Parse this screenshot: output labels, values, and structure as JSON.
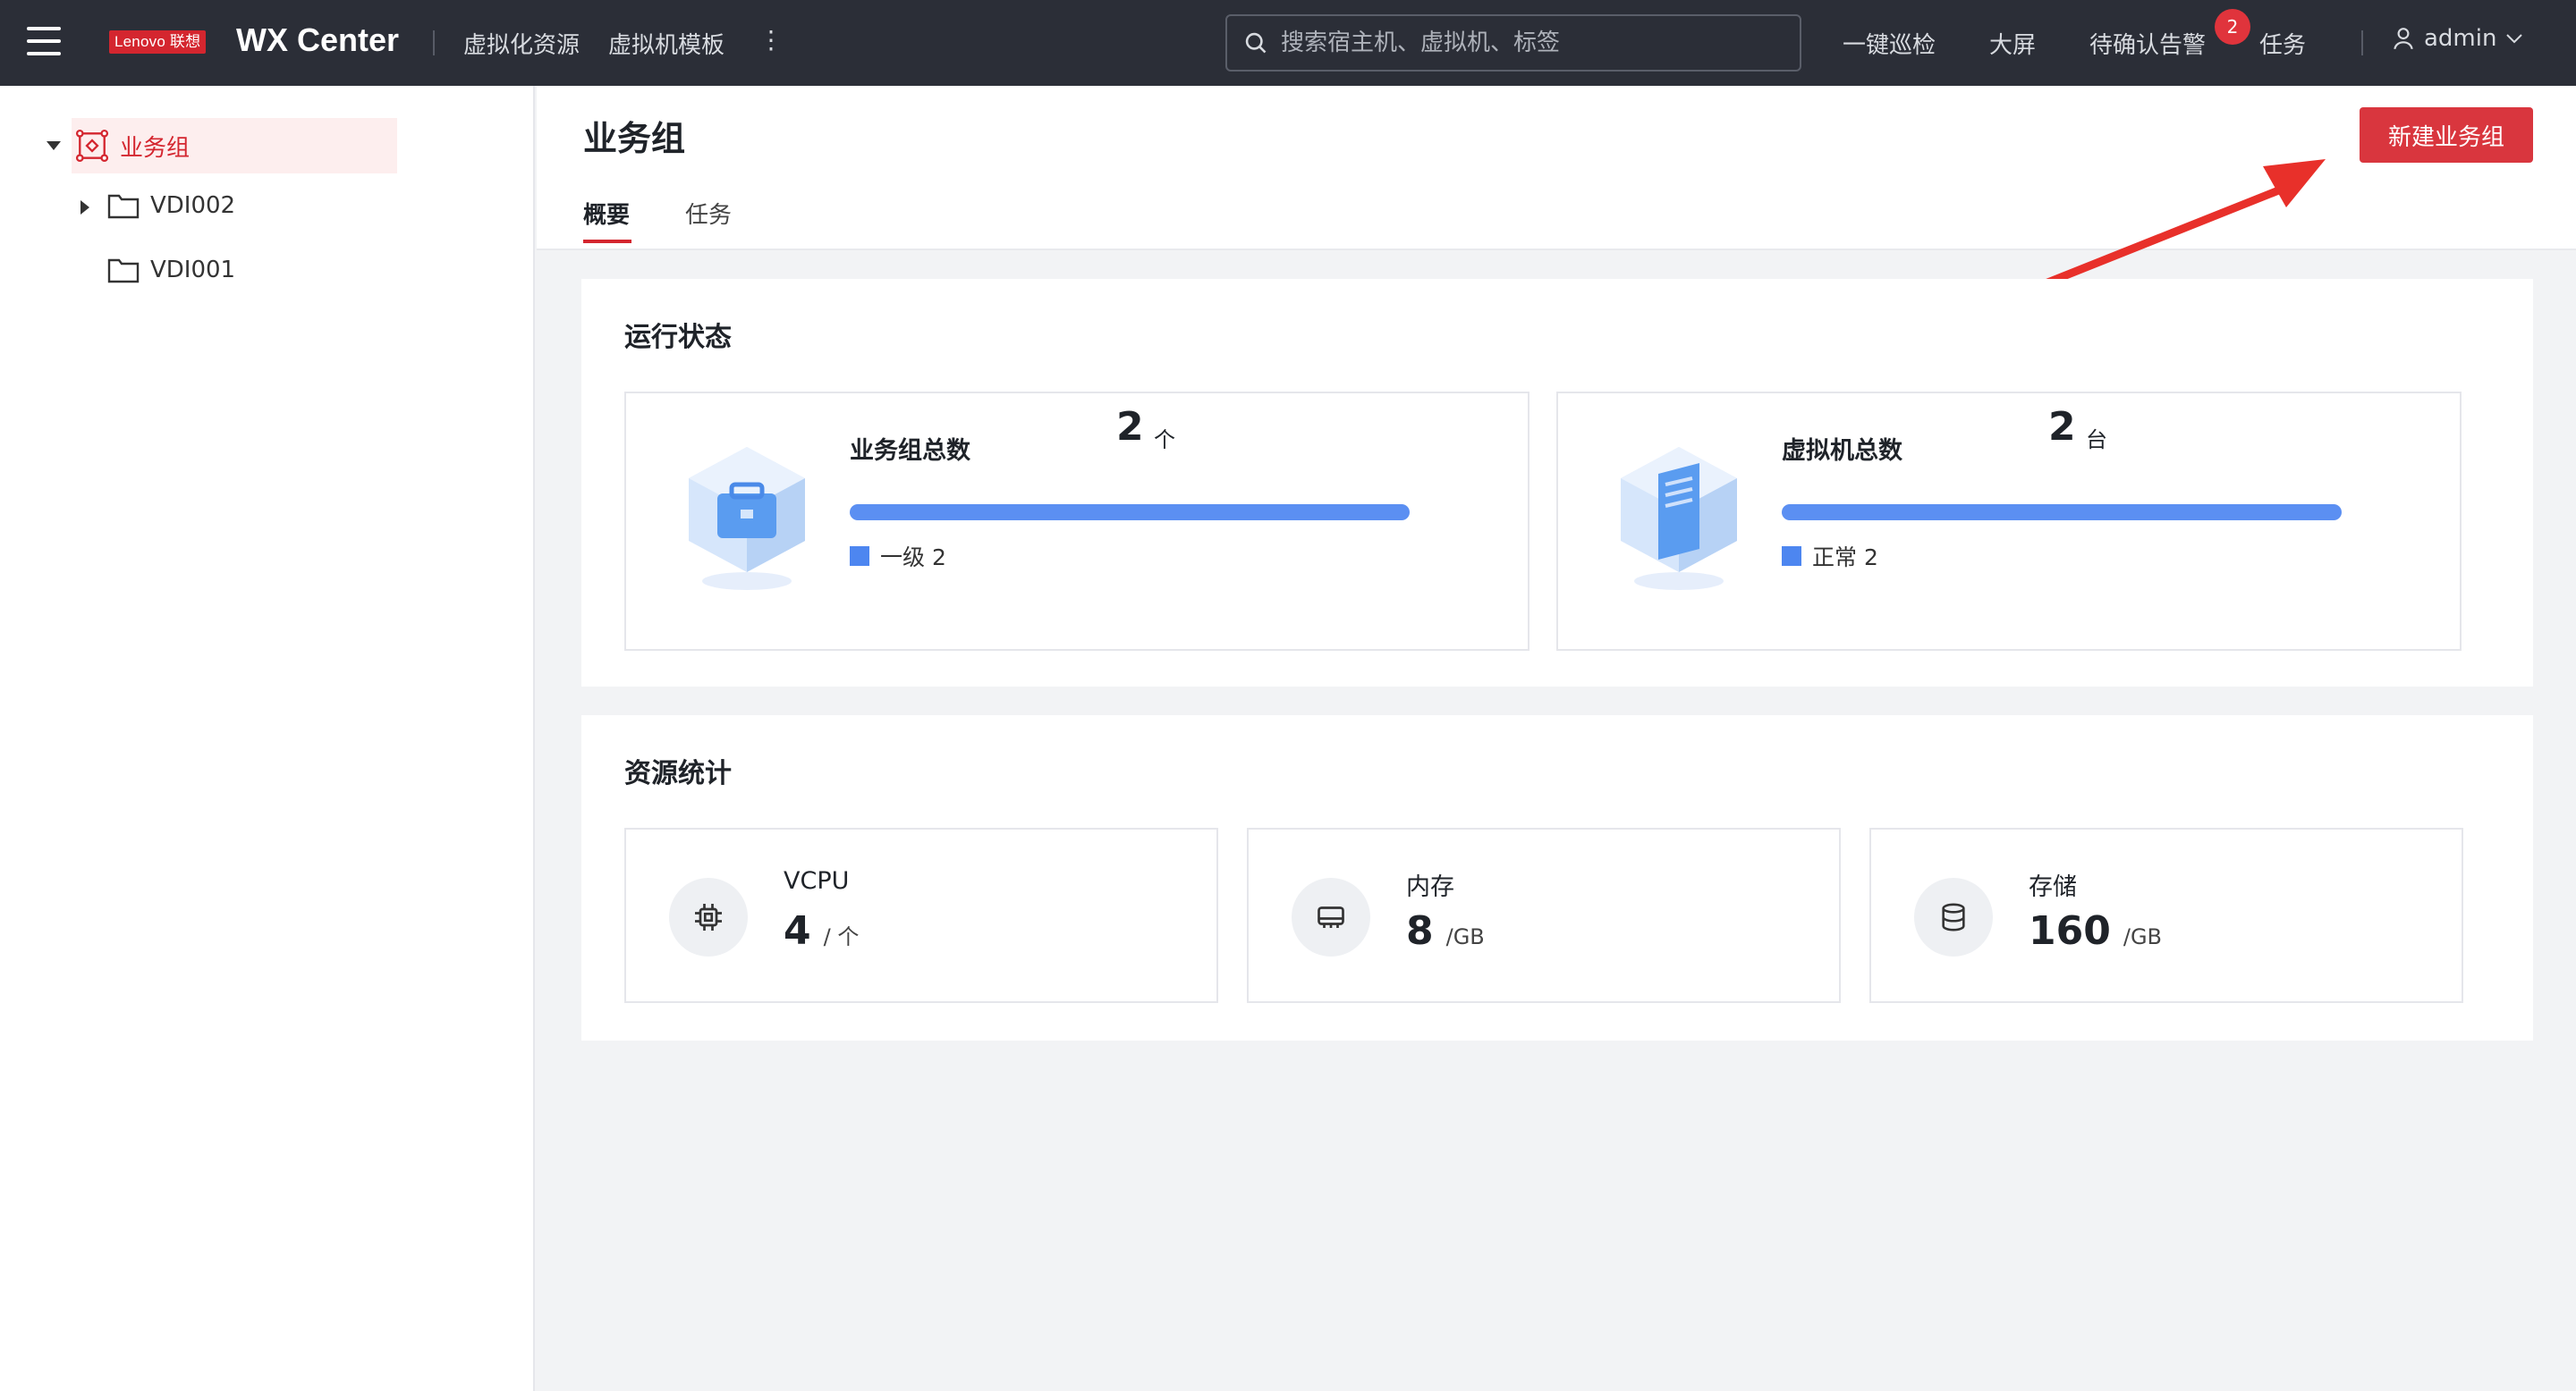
{
  "topbar": {
    "logo_text": "Lenovo 联想",
    "app_title": "WX Center",
    "nav": [
      "虚拟化资源",
      "虚拟机模板"
    ],
    "search_placeholder": "搜索宿主机、虚拟机、标签",
    "actions": [
      "一键巡检",
      "大屏",
      "待确认告警",
      "任务"
    ],
    "alert_badge": "2",
    "user": "admin"
  },
  "sidebar": {
    "root": "业务组",
    "children": [
      "VDI002",
      "VDI001"
    ]
  },
  "header": {
    "title": "业务组",
    "tabs": [
      "概要",
      "任务"
    ],
    "create_button": "新建业务组"
  },
  "status": {
    "title": "运行状态",
    "cards": [
      {
        "label": "业务组总数",
        "value": "2",
        "unit": "个",
        "legend": "一级 2"
      },
      {
        "label": "虚拟机总数",
        "value": "2",
        "unit": "台",
        "legend": "正常 2"
      }
    ]
  },
  "resources": {
    "title": "资源统计",
    "cards": [
      {
        "label": "VCPU",
        "value": "4",
        "unit": "/ 个",
        "icon": "cpu-icon"
      },
      {
        "label": "内存",
        "value": "8",
        "unit": "/GB",
        "icon": "memory-icon"
      },
      {
        "label": "存储",
        "value": "160",
        "unit": "/GB",
        "icon": "storage-icon"
      }
    ]
  },
  "colors": {
    "topbar": "#2b2e37",
    "accent": "#d4262f",
    "progress": "#5b8ff2",
    "annotation_arrow": "#e8302a"
  }
}
